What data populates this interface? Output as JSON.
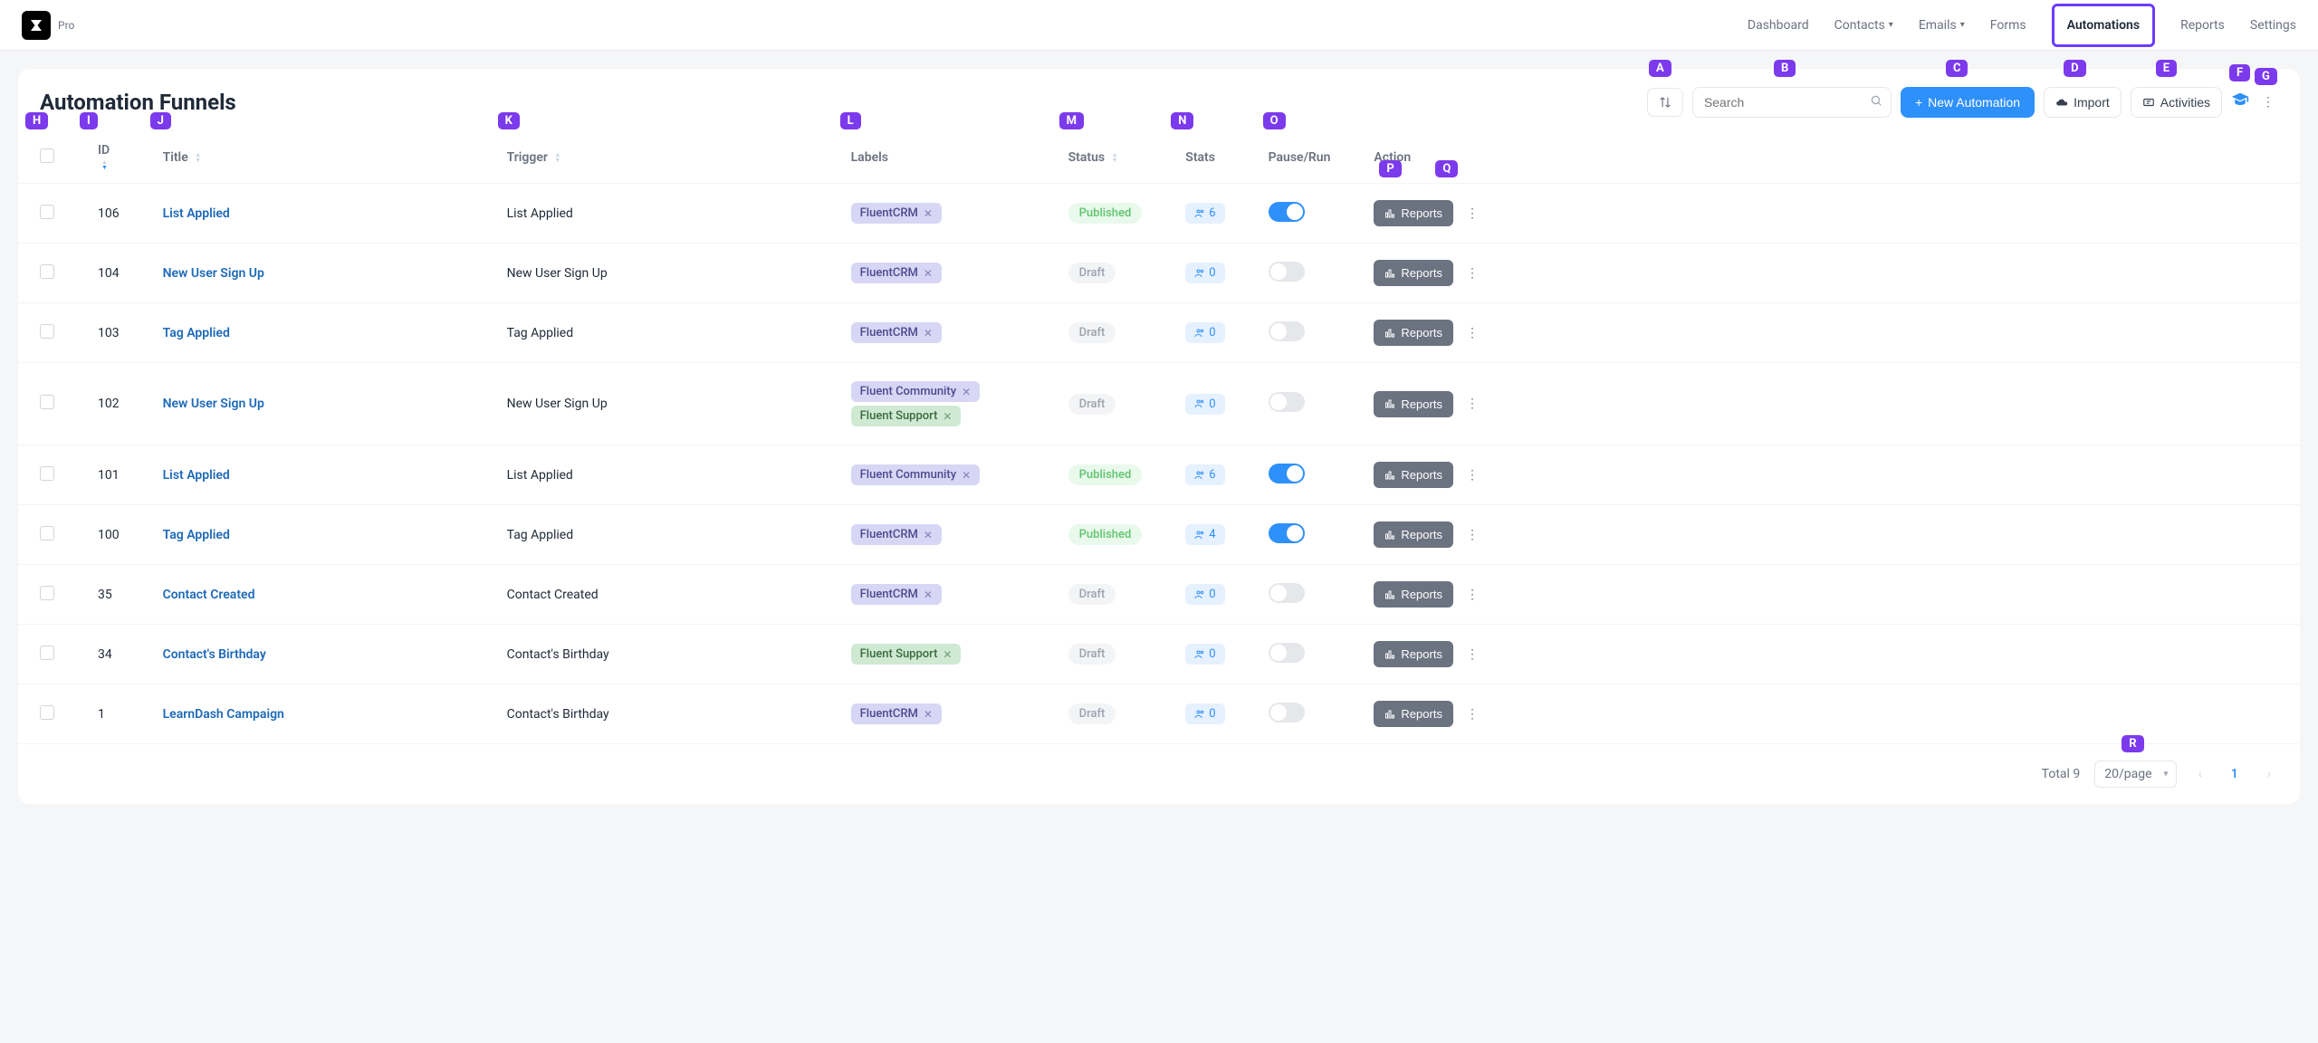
{
  "brand": {
    "pro": "Pro"
  },
  "nav": {
    "dashboard": "Dashboard",
    "contacts": "Contacts",
    "emails": "Emails",
    "forms": "Forms",
    "automations": "Automations",
    "reports": "Reports",
    "settings": "Settings"
  },
  "header": {
    "title": "Automation Funnels",
    "search_placeholder": "Search",
    "new_automation": "New Automation",
    "import": "Import",
    "activities": "Activities"
  },
  "columns": {
    "id": "ID",
    "title": "Title",
    "trigger": "Trigger",
    "labels": "Labels",
    "status": "Status",
    "stats": "Stats",
    "pause_run": "Pause/Run",
    "action": "Action"
  },
  "status_labels": {
    "published": "Published",
    "draft": "Draft"
  },
  "action_label": "Reports",
  "rows": [
    {
      "id": "106",
      "title": "List Applied",
      "trigger": "List Applied",
      "labels": [
        {
          "t": "FluentCRM",
          "c": "lav"
        }
      ],
      "status": "published",
      "stat": "6",
      "on": true
    },
    {
      "id": "104",
      "title": "New User Sign Up",
      "trigger": "New User Sign Up",
      "labels": [
        {
          "t": "FluentCRM",
          "c": "lav"
        }
      ],
      "status": "draft",
      "stat": "0",
      "on": false
    },
    {
      "id": "103",
      "title": "Tag Applied",
      "trigger": "Tag Applied",
      "labels": [
        {
          "t": "FluentCRM",
          "c": "lav"
        }
      ],
      "status": "draft",
      "stat": "0",
      "on": false
    },
    {
      "id": "102",
      "title": "New User Sign Up",
      "trigger": "New User Sign Up",
      "labels": [
        {
          "t": "Fluent Community",
          "c": "lav"
        },
        {
          "t": "Fluent Support",
          "c": "green"
        }
      ],
      "status": "draft",
      "stat": "0",
      "on": false
    },
    {
      "id": "101",
      "title": "List Applied",
      "trigger": "List Applied",
      "labels": [
        {
          "t": "Fluent Community",
          "c": "lav"
        }
      ],
      "status": "published",
      "stat": "6",
      "on": true
    },
    {
      "id": "100",
      "title": "Tag Applied",
      "trigger": "Tag Applied",
      "labels": [
        {
          "t": "FluentCRM",
          "c": "lav"
        }
      ],
      "status": "published",
      "stat": "4",
      "on": true
    },
    {
      "id": "35",
      "title": "Contact Created",
      "trigger": "Contact Created",
      "labels": [
        {
          "t": "FluentCRM",
          "c": "lav"
        }
      ],
      "status": "draft",
      "stat": "0",
      "on": false
    },
    {
      "id": "34",
      "title": "Contact's Birthday",
      "trigger": "Contact's Birthday",
      "labels": [
        {
          "t": "Fluent Support",
          "c": "green"
        }
      ],
      "status": "draft",
      "stat": "0",
      "on": false
    },
    {
      "id": "1",
      "title": "LearnDash Campaign",
      "trigger": "Contact's Birthday",
      "labels": [
        {
          "t": "FluentCRM",
          "c": "lav"
        }
      ],
      "status": "draft",
      "stat": "0",
      "on": false
    }
  ],
  "footer": {
    "total_label": "Total 9",
    "page_size": "20/page",
    "current_page": "1"
  },
  "markers": [
    "A",
    "B",
    "C",
    "D",
    "E",
    "F",
    "G",
    "H",
    "I",
    "J",
    "K",
    "L",
    "M",
    "N",
    "O",
    "P",
    "Q",
    "R"
  ]
}
